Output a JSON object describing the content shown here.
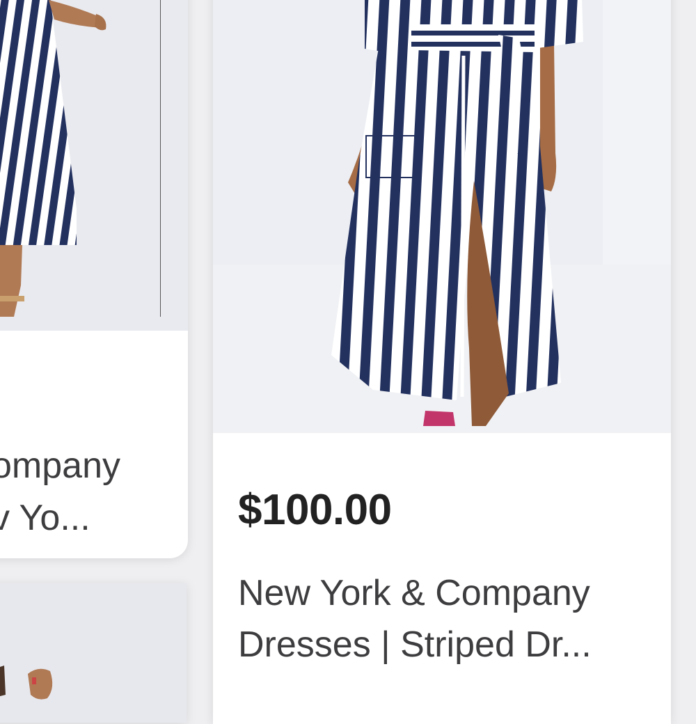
{
  "listings": [
    {
      "title_line1": "ompany",
      "title_line2": "v Yo..."
    },
    {
      "price": "$100.00",
      "title_line1": "New York & Company",
      "title_line2": "Dresses | Striped Dr..."
    },
    {}
  ],
  "colors": {
    "background": "#efeff1",
    "card": "#ffffff",
    "price_text": "#222222",
    "title_text": "#3d3d3f",
    "stripe_navy": "#23315f"
  }
}
